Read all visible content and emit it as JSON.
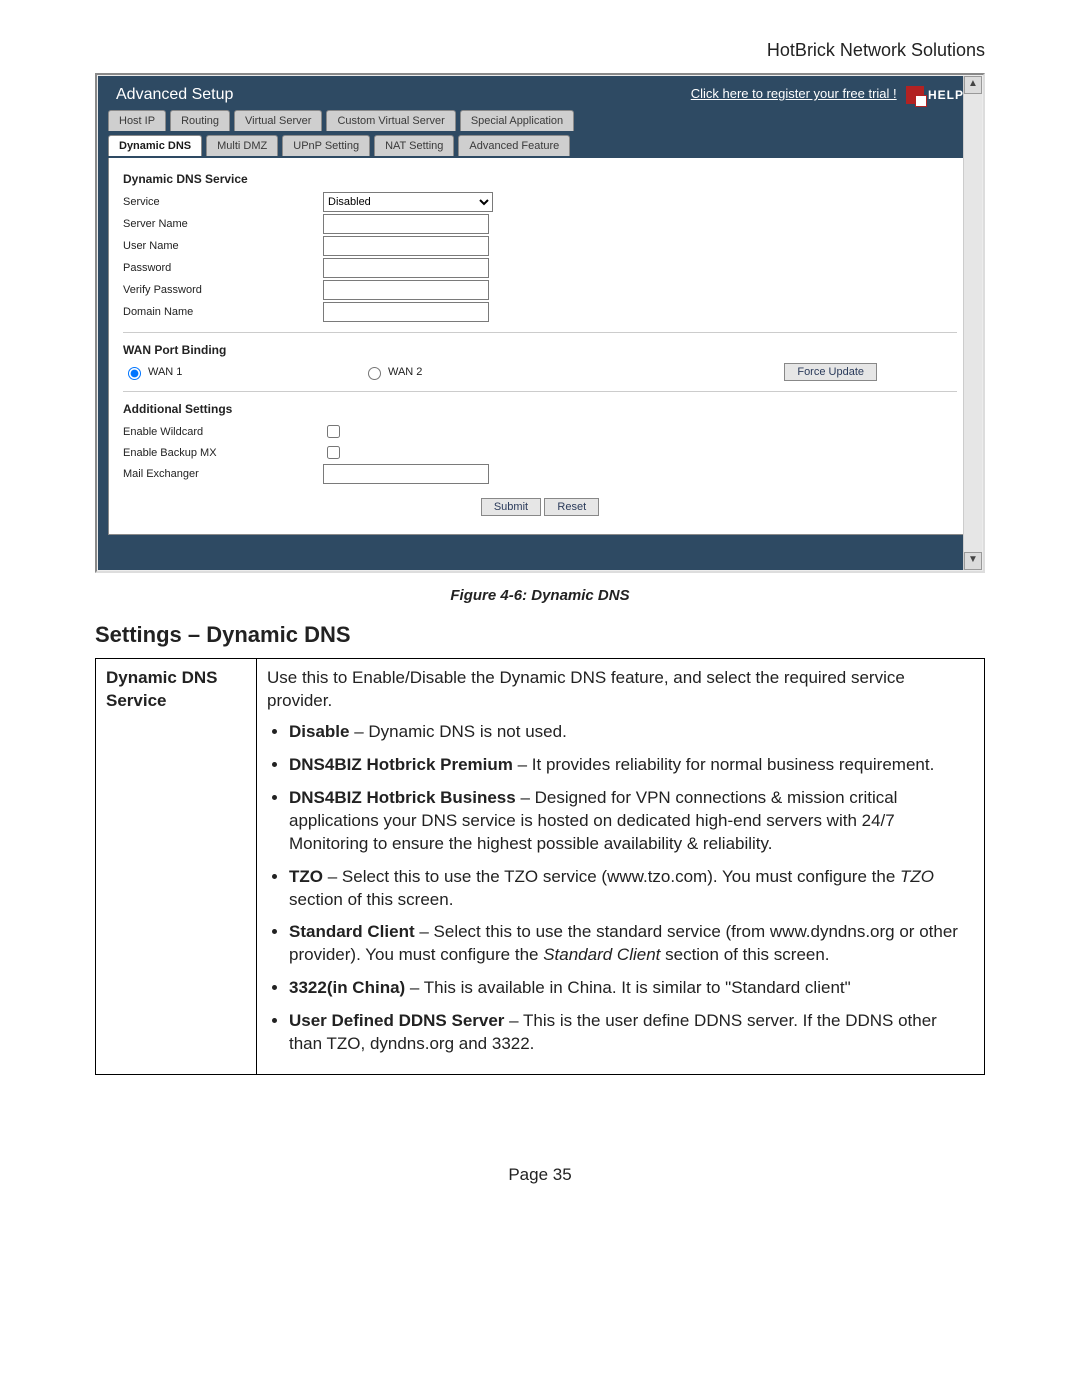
{
  "doc_header": "HotBrick Network Solutions",
  "app": {
    "title": "Advanced Setup",
    "register_link": "Click here to register your free trial !",
    "help_label": "HELP",
    "tabs_row1": [
      "Host IP",
      "Routing",
      "Virtual Server",
      "Custom Virtual Server",
      "Special Application"
    ],
    "tabs_row2": [
      "Dynamic DNS",
      "Multi DMZ",
      "UPnP Setting",
      "NAT Setting",
      "Advanced Feature"
    ],
    "active_tab": "Dynamic DNS",
    "section1": {
      "title": "Dynamic DNS Service",
      "service_label": "Service",
      "service_value": "Disabled",
      "server_name_label": "Server Name",
      "server_name_value": "",
      "user_name_label": "User Name",
      "user_name_value": "",
      "password_label": "Password",
      "password_value": "",
      "verify_password_label": "Verify Password",
      "verify_password_value": "",
      "domain_name_label": "Domain Name",
      "domain_name_value": ""
    },
    "section2": {
      "title": "WAN Port Binding",
      "wan1_label": "WAN 1",
      "wan2_label": "WAN 2",
      "selected": "wan1",
      "force_update_label": "Force Update"
    },
    "section3": {
      "title": "Additional Settings",
      "enable_wildcard_label": "Enable Wildcard",
      "enable_backup_mx_label": "Enable Backup MX",
      "mail_exchanger_label": "Mail Exchanger",
      "mail_exchanger_value": ""
    },
    "submit_label": "Submit",
    "reset_label": "Reset"
  },
  "figure_caption": "Figure 4-6: Dynamic DNS",
  "settings_heading": "Settings – Dynamic DNS",
  "table": {
    "key": "Dynamic DNS Service",
    "intro": "Use this to Enable/Disable the Dynamic DNS feature, and select the required service provider.",
    "items": [
      {
        "b": "Disable",
        "t": " – Dynamic DNS is not used."
      },
      {
        "b": "DNS4BIZ Hotbrick Premium",
        "t": " – It provides reliability for normal business requirement."
      },
      {
        "b": "DNS4BIZ Hotbrick Business",
        "t": " – Designed for VPN connections & mission critical applications your DNS service is hosted on dedicated high-end servers with 24/7 Monitoring to ensure the highest possible availability & reliability."
      },
      {
        "b": "TZO",
        "t": " – Select this to use the TZO service (www.tzo.com). You must configure the ",
        "i": "TZO",
        "t2": " section of this screen."
      },
      {
        "b": "Standard Client",
        "t": " – Select this to use the standard service (from www.dyndns.org or other provider). You must configure the ",
        "i": "Standard Client",
        "t2": " section of this screen."
      },
      {
        "b": "3322(in China)",
        "t": " – This is available in China. It is similar to \"Standard client\""
      },
      {
        "b": "User Defined DDNS Server",
        "t": " – This is the user define DDNS server. If the DDNS other than TZO, dyndns.org and 3322."
      }
    ]
  },
  "page_number": "Page 35"
}
